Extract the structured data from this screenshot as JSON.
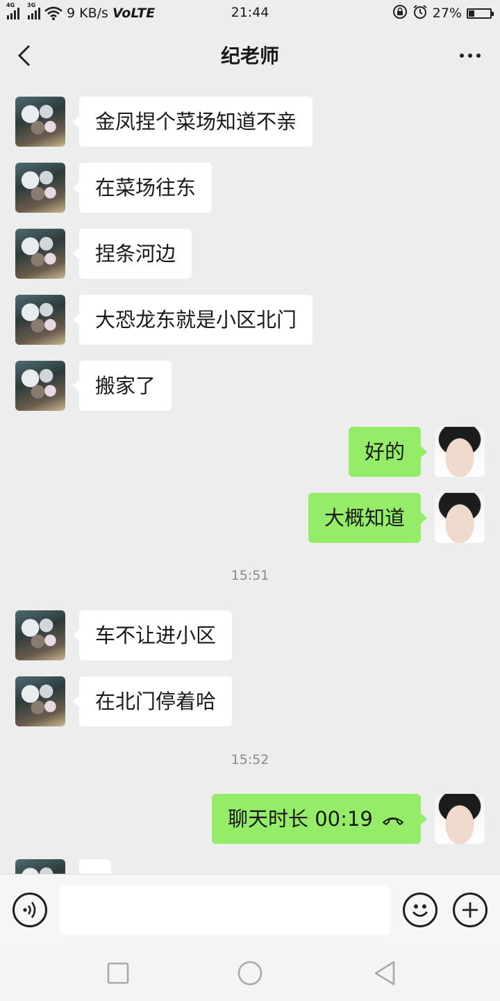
{
  "status_bar": {
    "net_1": "4G",
    "net_2": "3G",
    "speed": "9 KB/s",
    "volte": "VoLTE",
    "time": "21:44",
    "battery": "27%",
    "battery_level": 0.27
  },
  "header": {
    "title": "纪老师"
  },
  "messages": [
    {
      "side": "in",
      "text": "金凤捏个菜场知道不亲"
    },
    {
      "side": "in",
      "text": "在菜场往东"
    },
    {
      "side": "in",
      "text": "捏条河边"
    },
    {
      "side": "in",
      "text": "大恐龙东就是小区北门"
    },
    {
      "side": "in",
      "text": "搬家了"
    },
    {
      "side": "out",
      "text": "好的"
    },
    {
      "side": "out",
      "text": "大概知道"
    },
    {
      "side": "time",
      "text": "15:51"
    },
    {
      "side": "in",
      "text": "车不让进小区"
    },
    {
      "side": "in",
      "text": "在北门停着哈"
    },
    {
      "side": "time",
      "text": "15:52"
    },
    {
      "side": "out",
      "text": "聊天时长 00:19",
      "icon": "phone-hangup-icon"
    },
    {
      "side": "in",
      "text": ""
    }
  ],
  "input": {
    "value": "",
    "placeholder": ""
  },
  "colors": {
    "background": "#ededed",
    "bubble_in": "#ffffff",
    "bubble_out": "#95ec69",
    "timestamp": "#8a8a8a"
  }
}
